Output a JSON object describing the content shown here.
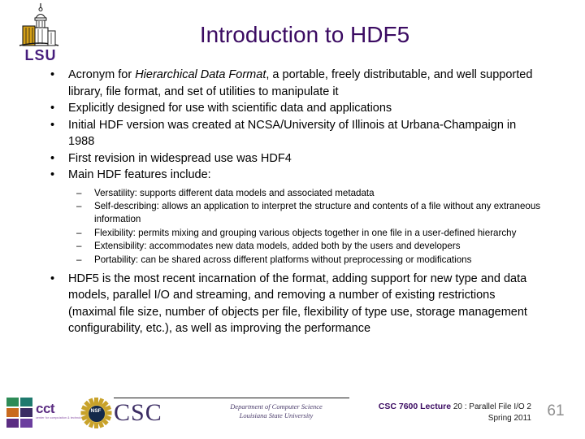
{
  "logo": {
    "lsu_text": "LSU",
    "lsu_alt": "lsu-tower-logo",
    "brand_purple": "#461D7C"
  },
  "title": {
    "text": "Introduction to HDF5",
    "color": "#3B0B62"
  },
  "body": {
    "bullet_marker": "•",
    "sub_marker": "–",
    "bullets": [
      {
        "pre": "Acronym for ",
        "italic": "Hierarchical Data Format",
        "post": ", a portable, freely distributable, and well supported library, file format, and set of utilities to manipulate it"
      },
      {
        "text": "Explicitly designed for use with scientific data and applications"
      },
      {
        "text": "Initial HDF version was created at NCSA/University of Illinois at Urbana-Champaign in 1988"
      },
      {
        "text": "First revision in widespread use was HDF4"
      },
      {
        "text": "Main HDF features include:"
      }
    ],
    "sub_bullets": [
      "Versatility: supports different data models and associated metadata",
      "Self-describing: allows an application to interpret the structure and contents of a file without any extraneous information",
      "Flexibility: permits mixing and grouping various objects together in one file in a user-defined hierarchy",
      "Extensibility: accommodates new data models, added both by the users and developers",
      "Portability: can be shared across different platforms without preprocessing or modifications"
    ],
    "closing_bullet": "HDF5 is the most recent incarnation of the format, adding support for new type and data models, parallel I/O and streaming, and removing a number of existing restrictions (maximal file size, number of objects per file, flexibility of type use, storage management configurability, etc.), as well as improving the performance"
  },
  "footer": {
    "cct": {
      "word": "cct",
      "subtitle": "center for computation & technology",
      "square_colors": [
        "#2E8B57",
        "#1F7A6E",
        "#C96A1E",
        "#3B2C63",
        "#5B2D82",
        "#6B3E9E"
      ]
    },
    "nsf": {
      "word": "NSF",
      "alt": "nsf-seal-logo"
    },
    "csc": {
      "word": "CSC",
      "dept_line1": "Department of Computer Science",
      "dept_line2": "Louisiana State University"
    },
    "course_label": "CSC 7600 Lecture",
    "lecture_info": "20 : Parallel File I/O 2",
    "term": "Spring 2011",
    "slide_number": "61"
  }
}
